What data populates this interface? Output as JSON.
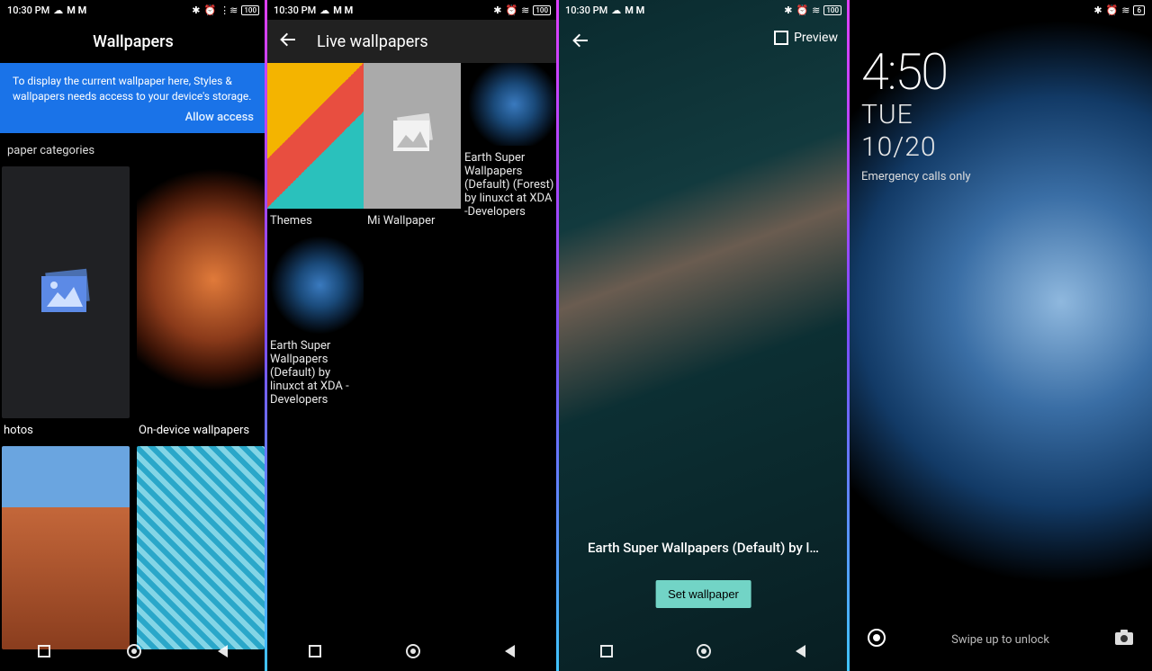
{
  "status": {
    "time": "10:30 PM"
  },
  "screen1": {
    "title": "Wallpapers",
    "banner": "To display the current wallpaper here, Styles & wallpapers needs access to your device's storage.",
    "allow": "Allow access",
    "section": "paper categories",
    "myphotos": "hotos",
    "on_device": "On-device wallpapers"
  },
  "screen2": {
    "title": "Live wallpapers",
    "themes": "Themes",
    "miwallpaper": "Mi Wallpaper",
    "earth_forest": "Earth Super Wallpapers (Default) (Forest) by linuxct at XDA -Developers",
    "earth_default": "Earth Super Wallpapers (Default) by linuxct at XDA -Developers"
  },
  "screen3": {
    "preview": "Preview",
    "title": "Earth Super Wallpapers (Default) by l…",
    "set": "Set wallpaper"
  },
  "screen4": {
    "time": "4:50",
    "day": "TUE",
    "date": "10/20",
    "emergency": "Emergency calls only",
    "swipe": "Swipe up to unlock"
  }
}
